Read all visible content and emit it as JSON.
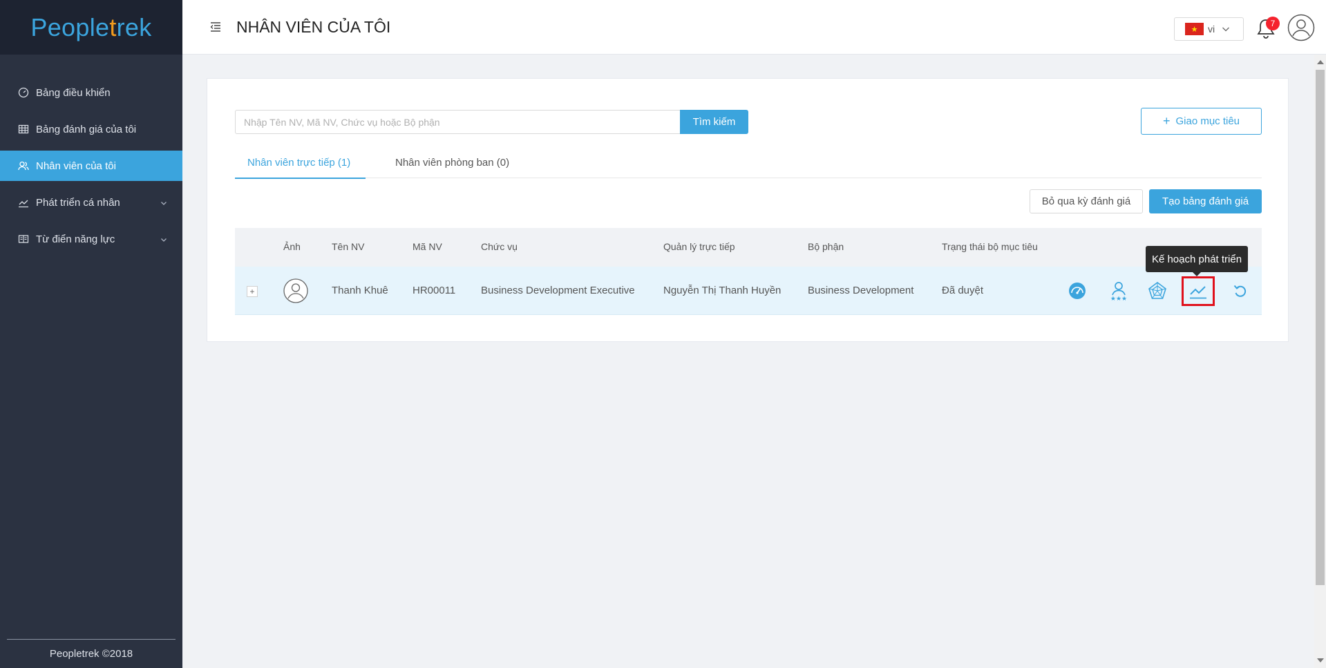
{
  "app": {
    "brand_pre": "People",
    "brand_t": "t",
    "brand_post": "rek"
  },
  "sidebar": {
    "items": [
      {
        "label": "Bảng điều khiển",
        "icon": "dashboard-icon"
      },
      {
        "label": "Bảng đánh giá của tôi",
        "icon": "table-icon"
      },
      {
        "label": "Nhân viên của tôi",
        "icon": "users-icon",
        "active": true
      },
      {
        "label": "Phát triển cá nhân",
        "icon": "chart-line-icon",
        "expandable": true
      },
      {
        "label": "Từ điển năng lực",
        "icon": "book-icon",
        "expandable": true
      }
    ],
    "footer": "Peopletrek ©2018"
  },
  "header": {
    "title": "NHÂN VIÊN CỦA TÔI",
    "lang": "vi",
    "notifications": "7"
  },
  "search": {
    "placeholder": "Nhập Tên NV, Mã NV, Chức vụ hoặc Bộ phận",
    "value": "",
    "button": "Tìm kiếm"
  },
  "goal_button": "Giao mục tiêu",
  "tabs": [
    {
      "label": "Nhân viên trực tiếp (1)",
      "active": true
    },
    {
      "label": "Nhân viên phòng ban (0)"
    }
  ],
  "actions": {
    "skip": "Bỏ qua kỳ đánh giá",
    "create": "Tạo bảng đánh giá"
  },
  "table": {
    "columns": [
      "Ảnh",
      "Tên NV",
      "Mã NV",
      "Chức vụ",
      "Quản lý trực tiếp",
      "Bộ phận",
      "Trạng thái bộ mục tiêu"
    ],
    "rows": [
      {
        "name": "Thanh Khuê",
        "code": "HR00011",
        "position": "Business Development Executive",
        "manager": "Nguyễn Thị Thanh Huyền",
        "department": "Business Development",
        "status": "Đã duyệt"
      }
    ]
  },
  "tooltip": "Kế hoạch phát triển",
  "colors": {
    "accent": "#3ba4dd",
    "sidebar": "#2b3241",
    "highlight": "#e0101b"
  }
}
